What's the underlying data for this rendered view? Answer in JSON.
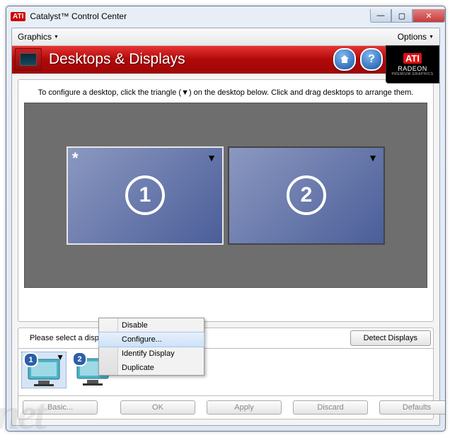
{
  "window": {
    "title": "Catalyst™ Control Center"
  },
  "menubar": {
    "graphics": "Graphics",
    "options": "Options"
  },
  "logo": {
    "brand": "ATI",
    "radeon": "RADEON",
    "sub": "PREMIUM GRAPHICS"
  },
  "banner": {
    "title": "Desktops & Displays",
    "help_glyph": "?"
  },
  "instruction": "To configure a desktop, click the triangle (▼) on the desktop below.  Click and drag desktops to arrange them.",
  "desktops": {
    "d1": "1",
    "d2": "2"
  },
  "lower": {
    "select_label": "Please select a display.",
    "detect": "Detect Displays",
    "thumbs": {
      "t1": "1",
      "t2": "2"
    }
  },
  "buttons": {
    "basic": "Basic...",
    "ok": "OK",
    "apply": "Apply",
    "discard": "Discard",
    "defaults": "Defaults"
  },
  "context": {
    "disable": "Disable",
    "configure": "Configure...",
    "identify": "Identify Display",
    "duplicate": "Duplicate"
  },
  "watermark": "net"
}
